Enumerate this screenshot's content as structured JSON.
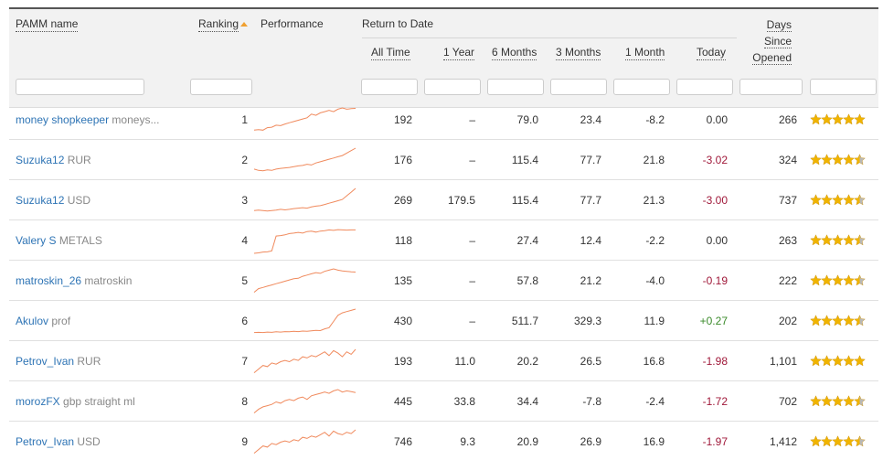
{
  "header": {
    "pamm_name": "PAMM name",
    "ranking": "Ranking",
    "performance": "Performance",
    "return_to_date": "Return to Date",
    "all_time": "All Time",
    "one_year": "1 Year",
    "six_months": "6 Months",
    "three_months": "3 Months",
    "one_month": "1 Month",
    "today": "Today",
    "days": "Days",
    "since": "Since",
    "opened": "Opened"
  },
  "colors": {
    "link": "#2e74b5",
    "negative": "#a0193a",
    "positive": "#3a8a2a",
    "sparkline": "#f08a5d",
    "star": "#f0b400"
  },
  "rows": [
    {
      "manager": "money shopkeeper",
      "account": "moneys...",
      "rank": "1",
      "all_time": "192",
      "one_year": "–",
      "six_months": "79.0",
      "three_months": "23.4",
      "one_month": "-8.2",
      "today": "0.00",
      "today_sign": "zero",
      "days": "266",
      "rating": 5.0,
      "spark": [
        0.1,
        0.12,
        0.1,
        0.2,
        0.22,
        0.3,
        0.28,
        0.35,
        0.4,
        0.45,
        0.5,
        0.55,
        0.6,
        0.75,
        0.7,
        0.8,
        0.85,
        0.9,
        0.85,
        0.95,
        1.0,
        0.95,
        0.97,
        0.98
      ]
    },
    {
      "manager": "Suzuka12",
      "account": "RUR",
      "rank": "2",
      "all_time": "176",
      "one_year": "–",
      "six_months": "115.4",
      "three_months": "77.7",
      "one_month": "21.8",
      "today": "-3.02",
      "today_sign": "neg",
      "days": "324",
      "rating": 4.5,
      "spark": [
        0.15,
        0.1,
        0.08,
        0.12,
        0.1,
        0.15,
        0.18,
        0.2,
        0.22,
        0.25,
        0.28,
        0.3,
        0.35,
        0.32,
        0.4,
        0.45,
        0.5,
        0.55,
        0.6,
        0.65,
        0.7,
        0.8,
        0.9,
        1.0
      ]
    },
    {
      "manager": "Suzuka12",
      "account": "USD",
      "rank": "3",
      "all_time": "269",
      "one_year": "179.5",
      "six_months": "115.4",
      "three_months": "77.7",
      "one_month": "21.3",
      "today": "-3.00",
      "today_sign": "neg",
      "days": "737",
      "rating": 4.5,
      "spark": [
        0.1,
        0.12,
        0.1,
        0.08,
        0.1,
        0.12,
        0.15,
        0.13,
        0.15,
        0.18,
        0.2,
        0.22,
        0.2,
        0.25,
        0.28,
        0.3,
        0.35,
        0.4,
        0.45,
        0.5,
        0.55,
        0.7,
        0.85,
        1.0
      ]
    },
    {
      "manager": "Valery S",
      "account": "METALS",
      "rank": "4",
      "all_time": "118",
      "one_year": "–",
      "six_months": "27.4",
      "three_months": "12.4",
      "one_month": "-2.2",
      "today": "0.00",
      "today_sign": "zero",
      "days": "263",
      "rating": 4.5,
      "spark": [
        0.0,
        0.02,
        0.05,
        0.06,
        0.1,
        0.7,
        0.72,
        0.75,
        0.8,
        0.82,
        0.85,
        0.82,
        0.88,
        0.9,
        0.86,
        0.9,
        0.92,
        0.95,
        0.93,
        0.96,
        0.95,
        0.94,
        0.95,
        0.95
      ]
    },
    {
      "manager": "matroskin_26",
      "account": "matroskin",
      "rank": "5",
      "all_time": "135",
      "one_year": "–",
      "six_months": "57.8",
      "three_months": "21.2",
      "one_month": "-4.0",
      "today": "-0.19",
      "today_sign": "neg",
      "days": "222",
      "rating": 4.5,
      "spark": [
        0.05,
        0.2,
        0.25,
        0.3,
        0.35,
        0.4,
        0.45,
        0.5,
        0.55,
        0.6,
        0.62,
        0.7,
        0.75,
        0.8,
        0.85,
        0.82,
        0.9,
        0.95,
        1.0,
        0.95,
        0.92,
        0.9,
        0.88,
        0.87
      ]
    },
    {
      "manager": "Akulov",
      "account": "prof",
      "rank": "6",
      "all_time": "430",
      "one_year": "–",
      "six_months": "511.7",
      "three_months": "329.3",
      "one_month": "11.9",
      "today": "+0.27",
      "today_sign": "pos",
      "days": "202",
      "rating": 4.5,
      "spark": [
        0.05,
        0.06,
        0.05,
        0.07,
        0.06,
        0.08,
        0.07,
        0.09,
        0.08,
        0.1,
        0.09,
        0.11,
        0.1,
        0.12,
        0.14,
        0.13,
        0.2,
        0.25,
        0.5,
        0.75,
        0.85,
        0.9,
        0.95,
        1.0
      ]
    },
    {
      "manager": "Petrov_Ivan",
      "account": "RUR",
      "rank": "7",
      "all_time": "193",
      "one_year": "11.0",
      "six_months": "20.2",
      "three_months": "26.5",
      "one_month": "16.8",
      "today": "-1.98",
      "today_sign": "neg",
      "days": "1,101",
      "rating": 5.0,
      "spark": [
        0.05,
        0.2,
        0.35,
        0.3,
        0.45,
        0.4,
        0.5,
        0.55,
        0.5,
        0.6,
        0.55,
        0.7,
        0.65,
        0.75,
        0.7,
        0.8,
        0.9,
        0.75,
        0.95,
        0.85,
        0.7,
        0.9,
        0.8,
        1.0
      ]
    },
    {
      "manager": "morozFX",
      "account": "gbp straight ml",
      "rank": "8",
      "all_time": "445",
      "one_year": "33.8",
      "six_months": "34.4",
      "three_months": "-7.8",
      "one_month": "-2.4",
      "today": "-1.72",
      "today_sign": "neg",
      "days": "702",
      "rating": 4.5,
      "spark": [
        0.05,
        0.2,
        0.3,
        0.35,
        0.4,
        0.5,
        0.45,
        0.55,
        0.6,
        0.55,
        0.65,
        0.7,
        0.6,
        0.75,
        0.8,
        0.85,
        0.9,
        0.85,
        0.95,
        1.0,
        0.9,
        0.95,
        0.92,
        0.88
      ]
    },
    {
      "manager": "Petrov_Ivan",
      "account": "USD",
      "rank": "9",
      "all_time": "746",
      "one_year": "9.3",
      "six_months": "20.9",
      "three_months": "26.9",
      "one_month": "16.9",
      "today": "-1.97",
      "today_sign": "neg",
      "days": "1,412",
      "rating": 4.5,
      "spark": [
        0.05,
        0.2,
        0.35,
        0.3,
        0.45,
        0.4,
        0.5,
        0.55,
        0.5,
        0.6,
        0.55,
        0.7,
        0.65,
        0.75,
        0.7,
        0.8,
        0.9,
        0.75,
        0.95,
        0.85,
        0.8,
        0.9,
        0.85,
        1.0
      ]
    }
  ]
}
